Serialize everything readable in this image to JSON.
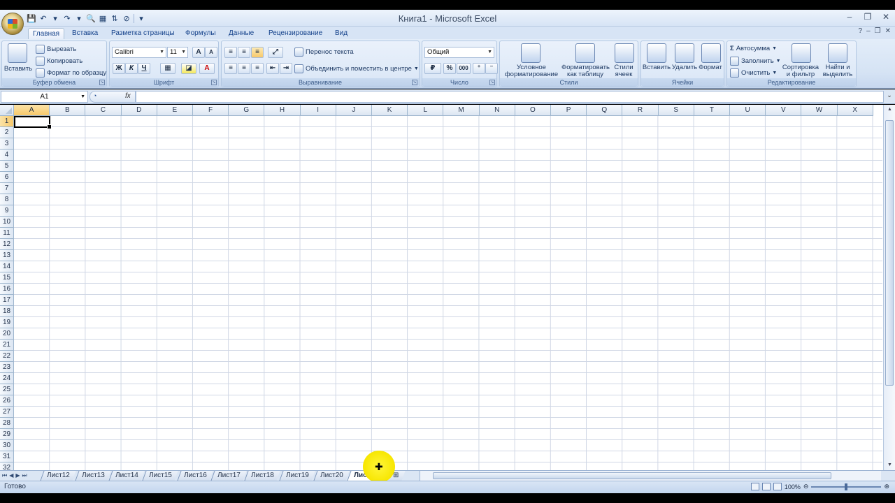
{
  "window": {
    "title": "Книга1 - Microsoft Excel",
    "controls": [
      "–",
      "❐",
      "✕"
    ]
  },
  "ribbon_tabs": [
    "Главная",
    "Вставка",
    "Разметка страницы",
    "Формулы",
    "Данные",
    "Рецензирование",
    "Вид"
  ],
  "clipboard": {
    "paste": "Вставить",
    "cut": "Вырезать",
    "copy": "Копировать",
    "format_painter": "Формат по образцу",
    "label": "Буфер обмена"
  },
  "font": {
    "name": "Calibri",
    "size": "11",
    "bold": "Ж",
    "italic": "К",
    "underline": "Ч",
    "grow": "A",
    "shrink": "A",
    "label": "Шрифт"
  },
  "alignment": {
    "wrap": "Перенос текста",
    "merge": "Объединить и поместить в центре",
    "label": "Выравнивание"
  },
  "number": {
    "format": "Общий",
    "percent": "%",
    "thousands": "000",
    "label": "Число"
  },
  "styles": {
    "conditional": "Условное форматирование",
    "table": "Форматировать как таблицу",
    "cell_styles": "Стили ячеек",
    "label": "Стили"
  },
  "cells": {
    "insert": "Вставить",
    "delete": "Удалить",
    "format": "Формат",
    "label": "Ячейки"
  },
  "editing": {
    "autosum": "Автосумма",
    "fill": "Заполнить",
    "clear": "Очистить",
    "sort": "Сортировка и фильтр",
    "find": "Найти и выделить",
    "label": "Редактирование"
  },
  "formula_bar": {
    "name_box": "A1",
    "fx": "fx",
    "value": ""
  },
  "grid": {
    "columns": [
      "A",
      "B",
      "C",
      "D",
      "E",
      "F",
      "G",
      "H",
      "I",
      "J",
      "K",
      "L",
      "M",
      "N",
      "O",
      "P",
      "Q",
      "R",
      "S",
      "T",
      "U",
      "V",
      "W",
      "X"
    ],
    "rows": [
      "1",
      "2",
      "3",
      "4",
      "5",
      "6",
      "7",
      "8",
      "9",
      "10",
      "11",
      "12",
      "13",
      "14",
      "15",
      "16",
      "17",
      "18",
      "19",
      "20",
      "21",
      "22",
      "23",
      "24",
      "25",
      "26",
      "27",
      "28",
      "29",
      "30",
      "31",
      "32"
    ],
    "selected_cell": "A1"
  },
  "sheets": {
    "tabs": [
      "Лист12",
      "Лист13",
      "Лист14",
      "Лист15",
      "Лист16",
      "Лист17",
      "Лист18",
      "Лист19",
      "Лист20",
      "Лист21"
    ],
    "active": "Лист21"
  },
  "status": {
    "text": "Готово",
    "zoom": "100%"
  }
}
